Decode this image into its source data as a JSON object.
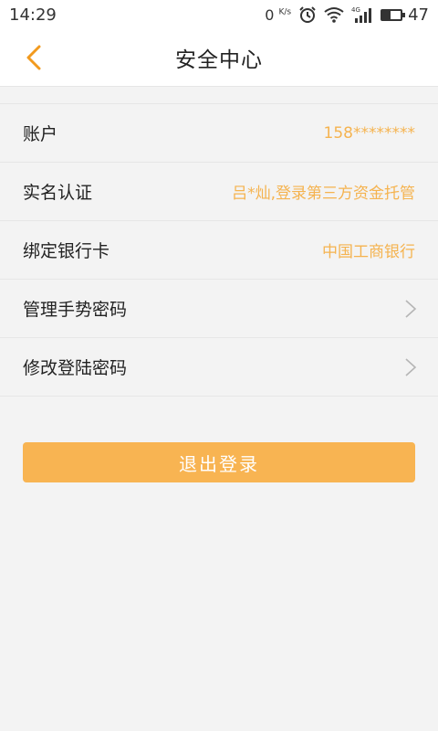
{
  "status_bar": {
    "time": "14:29",
    "net_speed": "0",
    "net_speed_unit": "K/s",
    "network_type": "4G",
    "battery_level": "47",
    "battery_fraction": 0.47
  },
  "header": {
    "title": "安全中心",
    "accent_color": "#f29a1e"
  },
  "items": [
    {
      "label": "账户",
      "value": "158********"
    },
    {
      "label": "实名认证",
      "value": "吕*灿,登录第三方资金托管"
    },
    {
      "label": "绑定银行卡",
      "value": "中国工商银行"
    },
    {
      "label": "管理手势密码",
      "icon": "chevron-right-icon"
    },
    {
      "label": "修改登陆密码",
      "icon": "chevron-right-icon"
    }
  ],
  "logout": {
    "label": "退出登录",
    "color": "#f8b452"
  }
}
